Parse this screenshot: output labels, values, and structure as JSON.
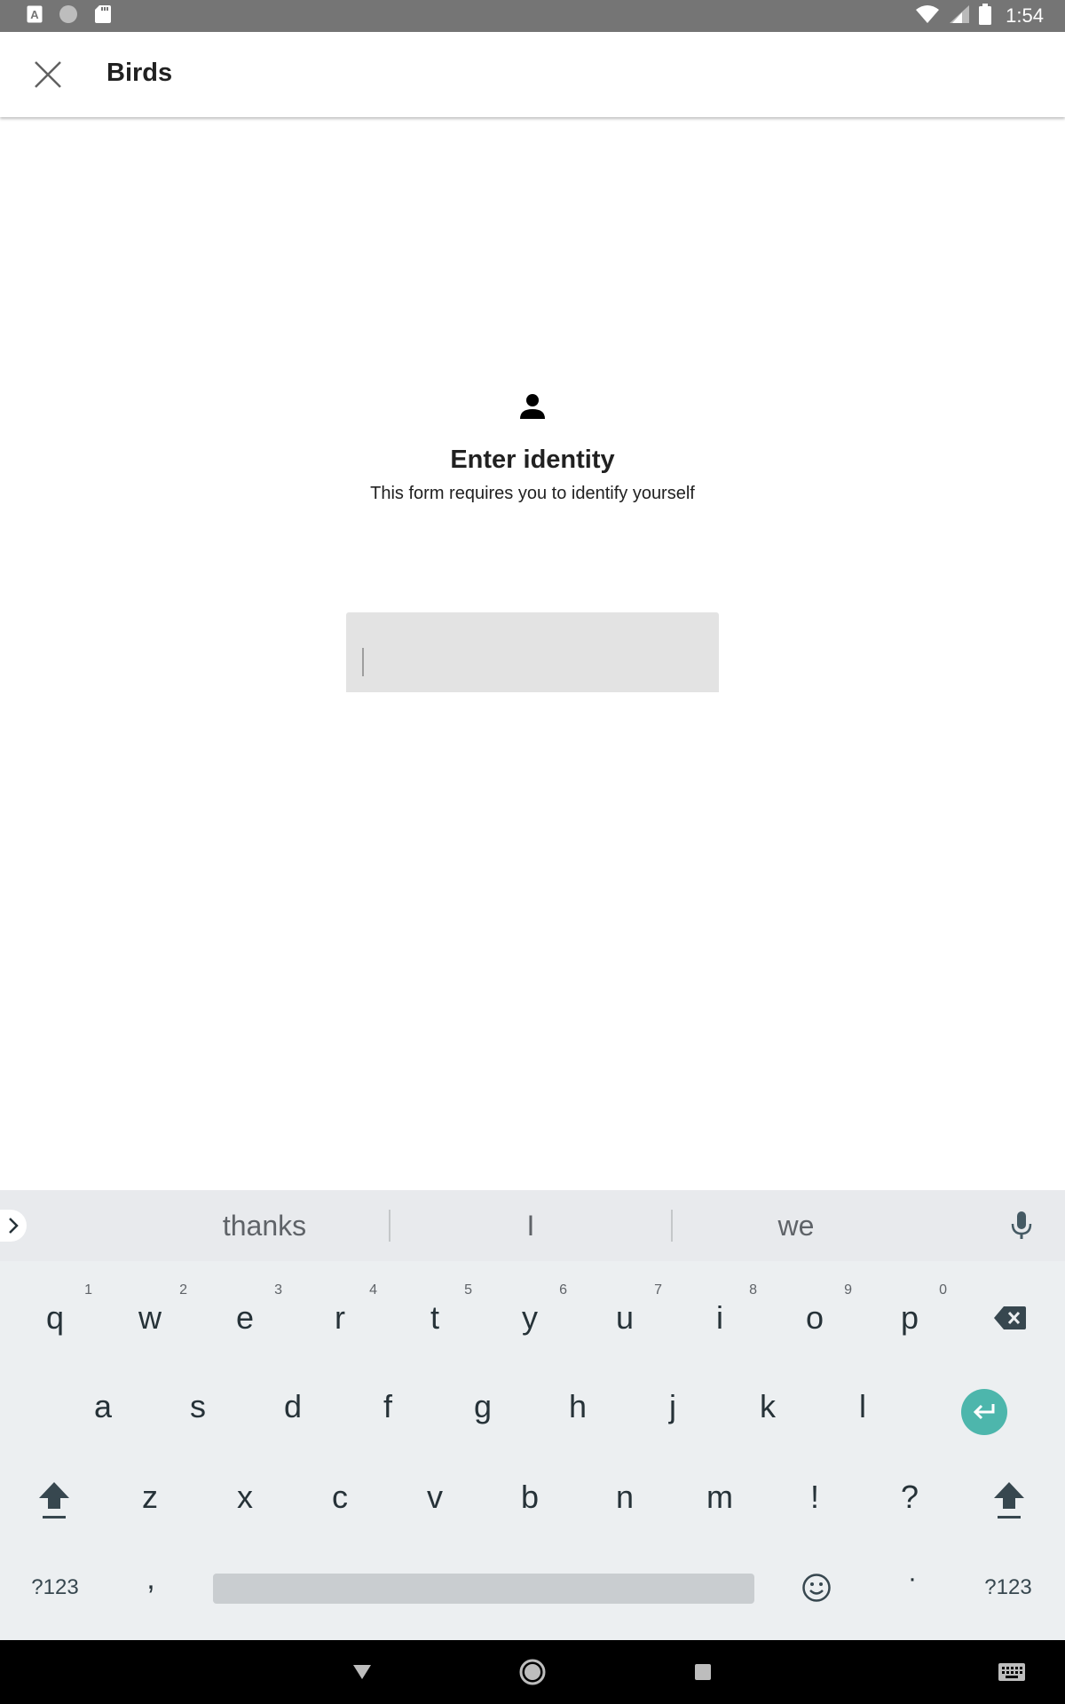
{
  "status_bar": {
    "time": "1:54",
    "left_icons": [
      "text-recognition-icon",
      "circle-notification-icon",
      "sd-card-icon"
    ],
    "right_icons": [
      "wifi-icon",
      "cell-signal-icon",
      "battery-icon"
    ]
  },
  "app_bar": {
    "title": "Birds",
    "close_icon": "close-icon"
  },
  "identity": {
    "icon": "person-icon",
    "heading": "Enter identity",
    "subheading": "This form requires you to identify yourself",
    "input_value": ""
  },
  "keyboard": {
    "suggestions": [
      "thanks",
      "I",
      "we"
    ],
    "row1": [
      {
        "key": "q",
        "hint": "1"
      },
      {
        "key": "w",
        "hint": "2"
      },
      {
        "key": "e",
        "hint": "3"
      },
      {
        "key": "r",
        "hint": "4"
      },
      {
        "key": "t",
        "hint": "5"
      },
      {
        "key": "y",
        "hint": "6"
      },
      {
        "key": "u",
        "hint": "7"
      },
      {
        "key": "i",
        "hint": "8"
      },
      {
        "key": "o",
        "hint": "9"
      },
      {
        "key": "p",
        "hint": "0"
      }
    ],
    "row2": [
      "a",
      "s",
      "d",
      "f",
      "g",
      "h",
      "j",
      "k",
      "l"
    ],
    "row3": [
      "z",
      "x",
      "c",
      "v",
      "b",
      "n",
      "m",
      "!",
      "?"
    ],
    "symbols_label": "?123",
    "comma_label": ",",
    "period_label": "·",
    "accent_color": "#4db6ac"
  },
  "nav_bar": {
    "icons": [
      "back-icon",
      "home-icon",
      "recents-icon",
      "keyboard-switch-icon"
    ]
  }
}
